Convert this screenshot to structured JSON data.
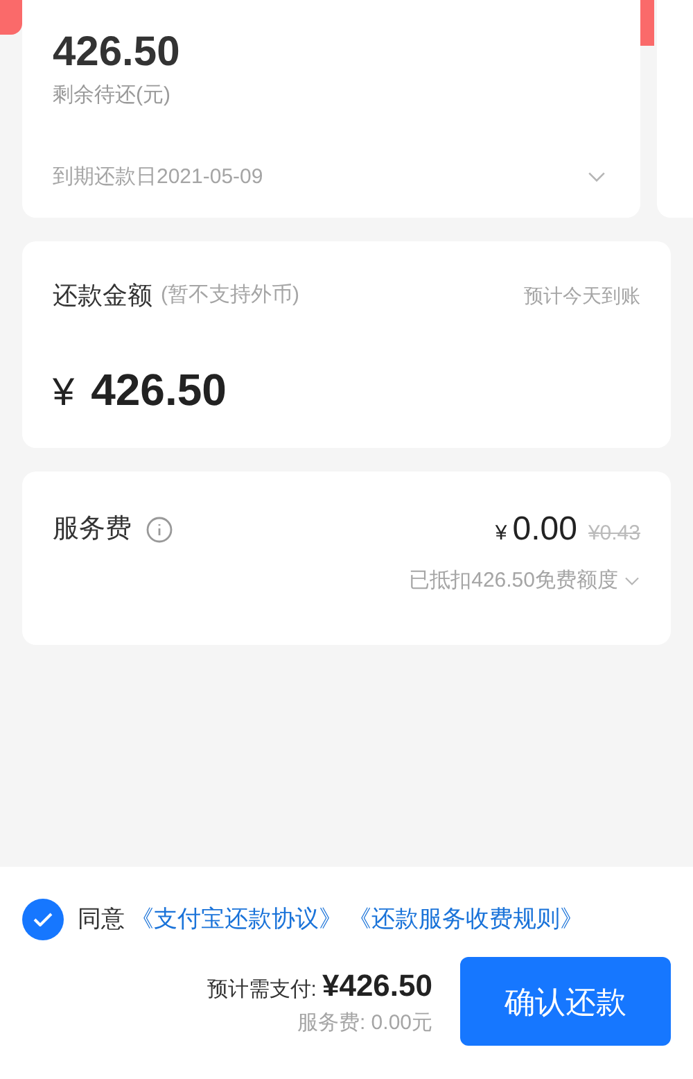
{
  "balance_card": {
    "amount": "426.50",
    "label": "剩余待还(元)",
    "due_date": "到期还款日2021-05-09",
    "expanded": false
  },
  "repay_card": {
    "title": "还款金额",
    "note": "(暂不支持外币)",
    "arrival": "预计今天到账",
    "currency": "¥",
    "amount": "426.50"
  },
  "fee_card": {
    "title": "服务费",
    "currency": "¥",
    "amount": "0.00",
    "original": "¥0.43",
    "deduction": "已抵扣426.50免费额度",
    "expanded": false
  },
  "footer": {
    "agree_checked": true,
    "agree_label": "同意",
    "links": [
      "《支付宝还款协议》",
      "《还款服务收费规则》"
    ],
    "total_label": "预计需支付:",
    "total": "¥426.50",
    "fee_line": "服务费: 0.00元",
    "confirm_button": "确认还款"
  }
}
